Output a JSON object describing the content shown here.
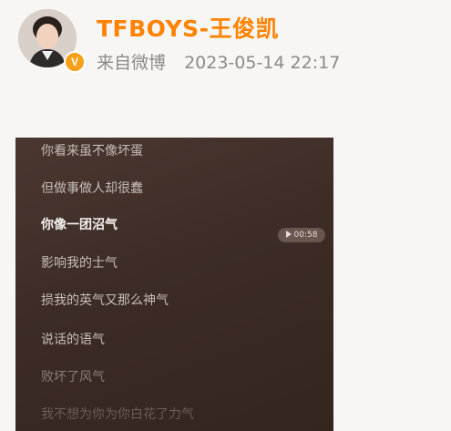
{
  "post": {
    "username": "TFBOYS-王俊凯",
    "source": "来自微博",
    "timestamp": "2023-05-14 22:17",
    "verified_badge": "V",
    "verified_color": "#f7a019",
    "username_color": "#ff8200"
  },
  "video": {
    "duration": "00:58",
    "lyrics": [
      "你看来虽不像坏蛋",
      "但做事做人却很蠢",
      "你像一团沼气",
      "影响我的士气",
      "损我的英气又那么神气",
      "说话的语气",
      "败坏了风气",
      "我不想为你为你白花了力气"
    ]
  }
}
